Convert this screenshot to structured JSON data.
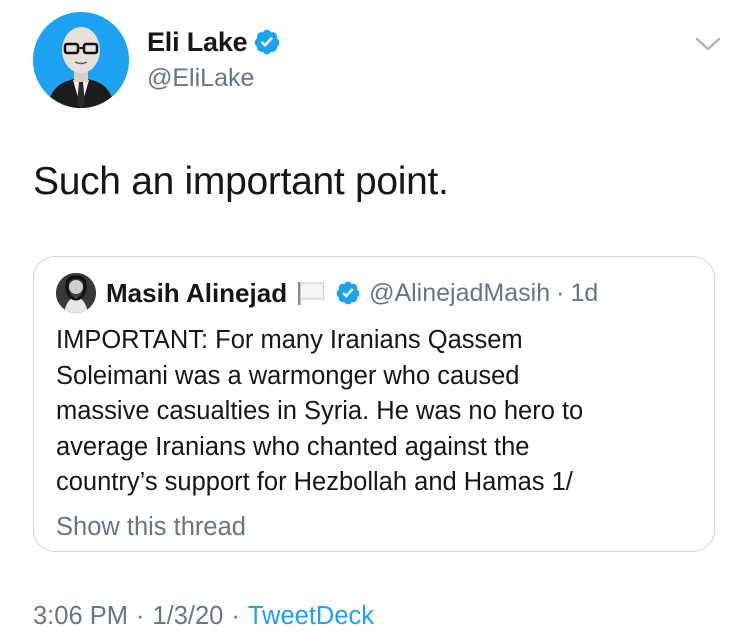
{
  "author": {
    "name": "Eli Lake",
    "handle": "@EliLake",
    "verified": true
  },
  "tweet": {
    "text": "Such an important point."
  },
  "quoted_tweet": {
    "name": "Masih Alinejad",
    "handle": "@AlinejadMasih",
    "separator": "·",
    "time": "1d",
    "verified": true,
    "lines": [
      "IMPORTANT: For many Iranians Qassem",
      "Soleimani was a warmonger who caused",
      "massive casualties in Syria. He was no hero to",
      "average Iranians who chanted against the",
      "country’s support for Hezbollah and Hamas 1/"
    ],
    "show_thread": "Show this thread"
  },
  "meta": {
    "time": "3:06 PM",
    "sep1": "·",
    "date": "1/3/20",
    "sep2": "·",
    "source": "TweetDeck"
  },
  "colors": {
    "text": "#14171a",
    "secondary": "#657786",
    "accent": "#1da1f2",
    "border": "#ccd6dd"
  },
  "icons": {
    "verified": "verified-badge-icon",
    "caret": "chevron-down-icon",
    "flag": "white-flag-icon"
  }
}
